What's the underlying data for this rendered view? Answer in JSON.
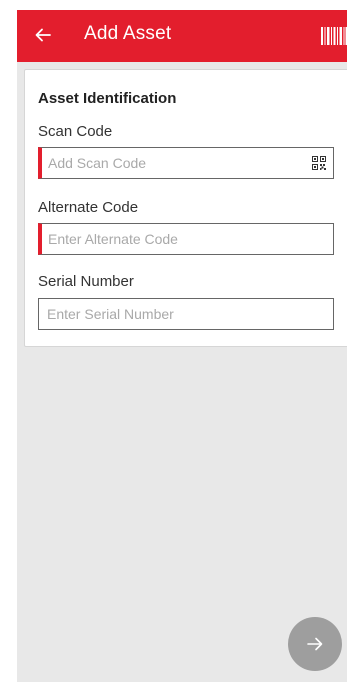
{
  "appbar": {
    "title": "Add Asset",
    "back_icon": "arrow-left-icon",
    "barcode_icon": "barcode-scan-icon",
    "color": "#e31e2d"
  },
  "form": {
    "section_title": "Asset Identification",
    "scan_code": {
      "label": "Scan Code",
      "placeholder": "Add Scan Code",
      "value": "",
      "icon": "qr-code-icon",
      "required": true
    },
    "alternate_code": {
      "label": "Alternate Code",
      "placeholder": "Enter Alternate Code",
      "value": "",
      "required": true
    },
    "serial_number": {
      "label": "Serial Number",
      "placeholder": "Enter Serial Number",
      "value": "",
      "required": false
    }
  },
  "fab": {
    "icon": "arrow-right-icon",
    "color": "#9e9e9e"
  }
}
